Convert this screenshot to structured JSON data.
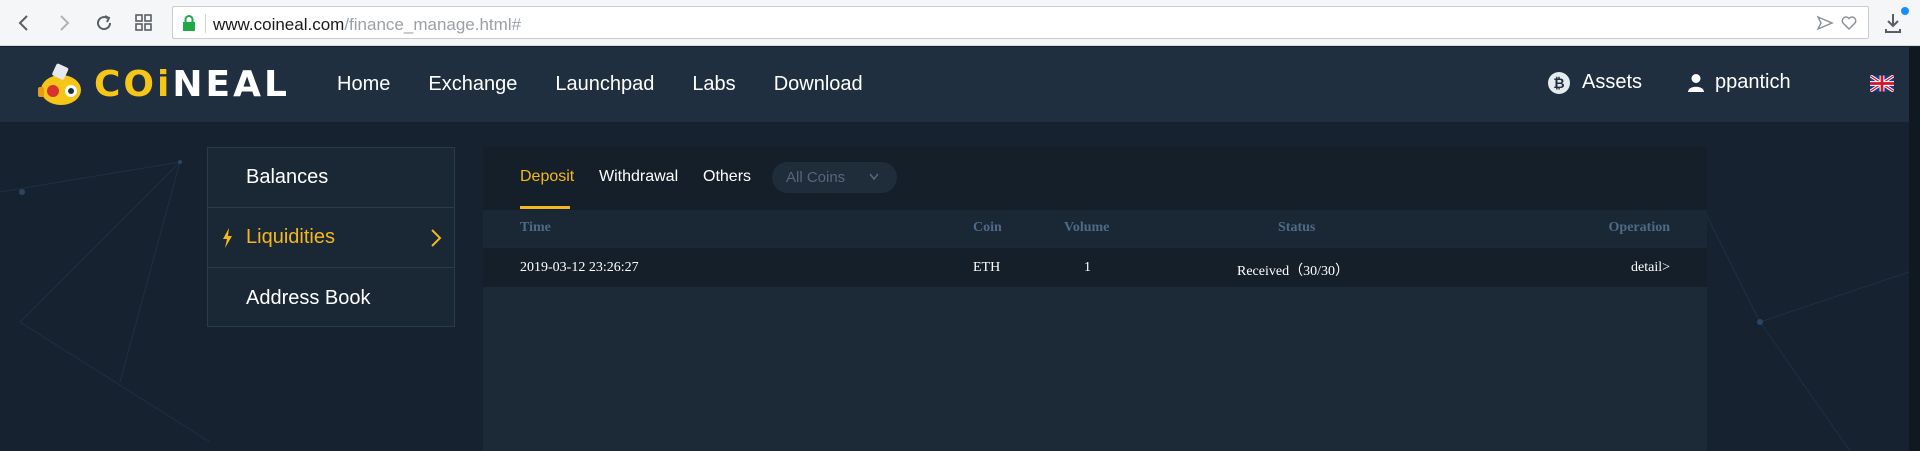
{
  "browser": {
    "url_host": "www.coineal.com",
    "url_path": "/finance_manage.html#"
  },
  "header": {
    "logo_text_a": "COi",
    "logo_text_b": "NEAL",
    "nav": [
      "Home",
      "Exchange",
      "Launchpad",
      "Labs",
      "Download"
    ],
    "assets_label": "Assets",
    "btc_symbol": "₿",
    "username": "ppantich"
  },
  "sidebar": {
    "items": [
      {
        "label": "Balances"
      },
      {
        "label": "Liquidities"
      },
      {
        "label": "Address Book"
      }
    ]
  },
  "main": {
    "tabs": [
      "Deposit",
      "Withdrawal",
      "Others"
    ],
    "coin_select": "All Coins",
    "columns": [
      "Time",
      "Coin",
      "Volume",
      "Status",
      "Operation"
    ],
    "rows": [
      {
        "time": "2019-03-12 23:26:27",
        "coin": "ETH",
        "volume": "1",
        "status": "Received（30/30）",
        "operation": "detail>"
      }
    ]
  },
  "colors": {
    "accent": "#f5b81c",
    "header_bg": "#1f2f40",
    "page_bg": "#16222f"
  }
}
